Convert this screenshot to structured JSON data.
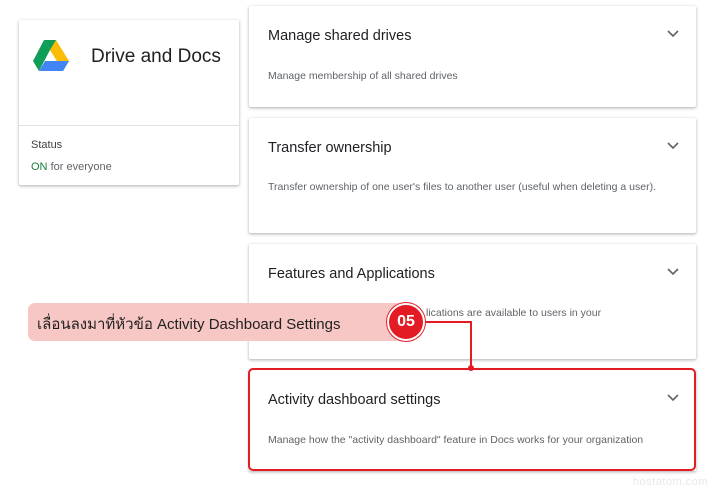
{
  "app": {
    "title": "Drive and Docs",
    "status_label": "Status",
    "status_value": "ON",
    "status_suffix": "for everyone",
    "status_color": "#188038",
    "logo": "google-drive-logo"
  },
  "settings": [
    {
      "title": "Manage shared drives",
      "description": "Manage membership of all shared drives",
      "icon": "chevron-down-icon"
    },
    {
      "title": "Transfer ownership",
      "description": "Transfer ownership of one user's files to another user (useful when deleting a user).",
      "icon": "chevron-down-icon"
    },
    {
      "title": "Features and Applications",
      "description": "lications are available to users in your",
      "icon": "chevron-down-icon"
    },
    {
      "title": "Activity dashboard settings",
      "description": "Manage how the \"activity dashboard\" feature in Docs works for your organization",
      "icon": "chevron-down-icon"
    }
  ],
  "callout": {
    "text": "เลื่อนลงมาที่หัวข้อ Activity Dashboard Settings",
    "step": "05",
    "accent": "#e21b24",
    "background": "#f6c7c4"
  },
  "watermark": "hostatom.com"
}
